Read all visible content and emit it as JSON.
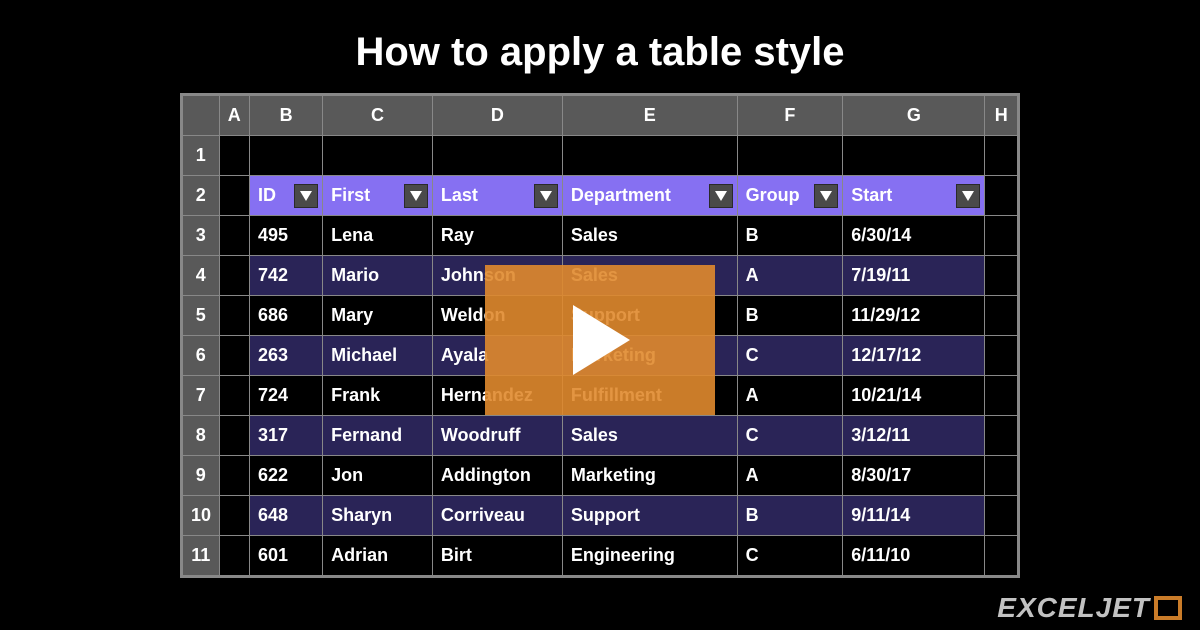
{
  "title": "How to apply a table style",
  "logo_text": "EXCELJET",
  "columns": [
    "A",
    "B",
    "C",
    "D",
    "E",
    "F",
    "G",
    "H"
  ],
  "row_numbers": [
    "1",
    "2",
    "3",
    "4",
    "5",
    "6",
    "7",
    "8",
    "9",
    "10",
    "11"
  ],
  "headers": {
    "id": "ID",
    "first": "First",
    "last": "Last",
    "department": "Department",
    "group": "Group",
    "start": "Start"
  },
  "rows": [
    {
      "id": "495",
      "first": "Lena",
      "last": "Ray",
      "department": "Sales",
      "group": "B",
      "start": "6/30/14"
    },
    {
      "id": "742",
      "first": "Mario",
      "last": "Johnson",
      "department": "Sales",
      "group": "A",
      "start": "7/19/11"
    },
    {
      "id": "686",
      "first": "Mary",
      "last": "Weldon",
      "department": "Support",
      "group": "B",
      "start": "11/29/12"
    },
    {
      "id": "263",
      "first": "Michael",
      "last": "Ayala",
      "department": "Marketing",
      "group": "C",
      "start": "12/17/12"
    },
    {
      "id": "724",
      "first": "Frank",
      "last": "Hernandez",
      "department": "Fulfillment",
      "group": "A",
      "start": "10/21/14"
    },
    {
      "id": "317",
      "first": "Fernand",
      "last": "Woodruff",
      "department": "Sales",
      "group": "C",
      "start": "3/12/11"
    },
    {
      "id": "622",
      "first": "Jon",
      "last": "Addington",
      "department": "Marketing",
      "group": "A",
      "start": "8/30/17"
    },
    {
      "id": "648",
      "first": "Sharyn",
      "last": "Corriveau",
      "department": "Support",
      "group": "B",
      "start": "9/11/14"
    },
    {
      "id": "601",
      "first": "Adrian",
      "last": "Birt",
      "department": "Engineering",
      "group": "C",
      "start": "6/11/10"
    }
  ]
}
